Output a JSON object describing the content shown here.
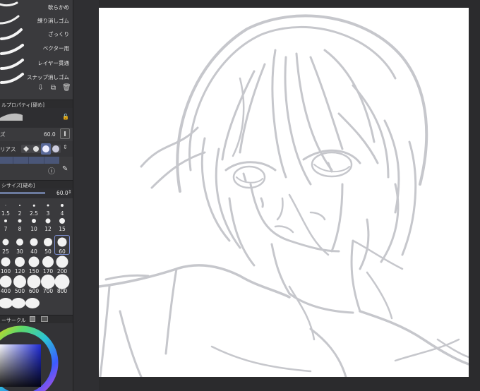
{
  "eraser_tools": [
    {
      "label": "軟らかめ"
    },
    {
      "label": "練り消しゴム"
    },
    {
      "label": "ざっくり"
    },
    {
      "label": "ベクター用"
    },
    {
      "label": "レイヤー貫通"
    },
    {
      "label": "スナップ消しゴム"
    }
  ],
  "tool_property": {
    "header": "ルプロパティ[硬め]",
    "size_value": "60.0",
    "size_label": "ズ",
    "antialias_label": "リアス"
  },
  "brush_size_panel": {
    "header": "シサイズ[硬め]",
    "slider_value": "60.0",
    "rows": [
      [
        "1.5",
        "2",
        "2.5",
        "3",
        "4"
      ],
      [
        "7",
        "8",
        "10",
        "12",
        "15"
      ],
      [
        "25",
        "30",
        "40",
        "50",
        "60"
      ],
      [
        "100",
        "120",
        "150",
        "170",
        "200"
      ],
      [
        "400",
        "500",
        "600",
        "700",
        "800"
      ]
    ],
    "selected": "60"
  },
  "color_circle": {
    "header": "ーサークル"
  },
  "colors": {
    "accent": "#5a6a9a",
    "panel": "#3a3a3d",
    "sketch": "#c8c9cd"
  }
}
